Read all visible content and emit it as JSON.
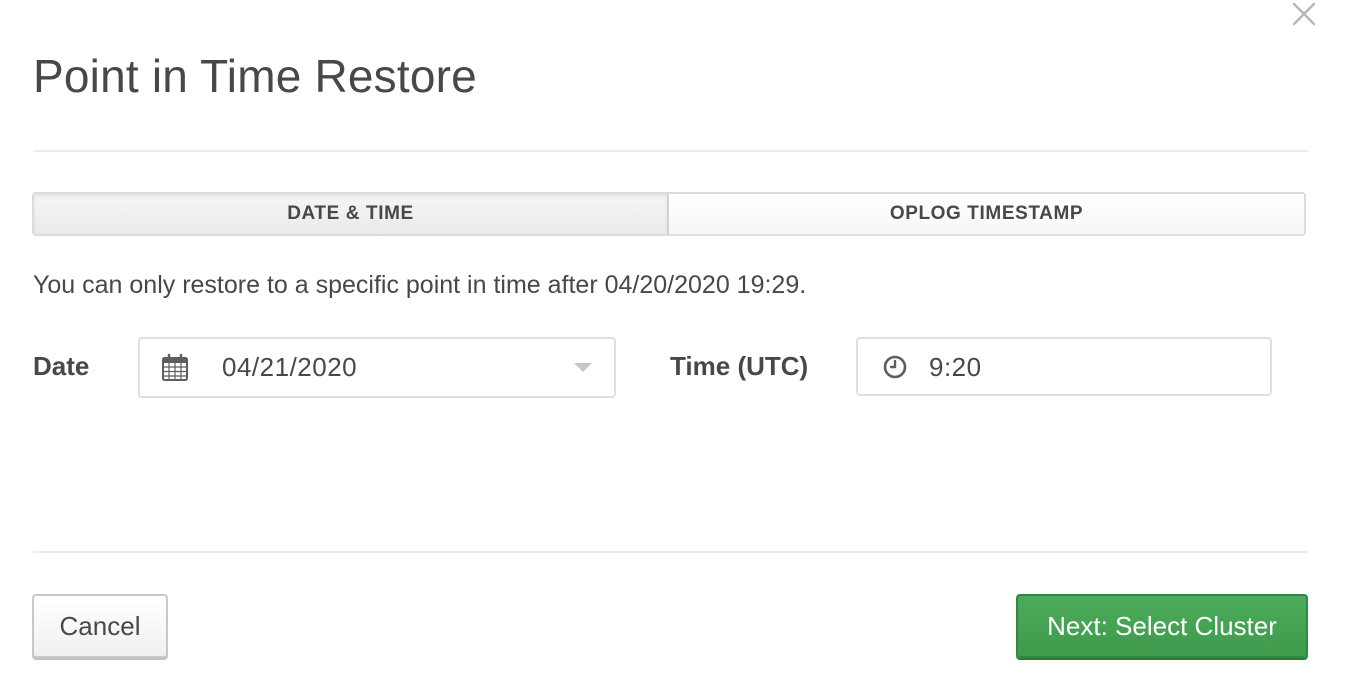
{
  "modal": {
    "title": "Point in Time Restore",
    "close_icon": "close-icon"
  },
  "tabs": [
    {
      "label": "DATE & TIME",
      "active": true
    },
    {
      "label": "OPLOG TIMESTAMP",
      "active": false
    }
  ],
  "info_text": "You can only restore to a specific point in time after 04/20/2020 19:29.",
  "date_field": {
    "label": "Date",
    "value": "04/21/2020",
    "icon": "calendar-icon"
  },
  "time_field": {
    "label": "Time (UTC)",
    "value": "9:20",
    "icon": "clock-icon"
  },
  "footer": {
    "cancel_label": "Cancel",
    "next_label": "Next: Select Cluster"
  },
  "colors": {
    "primary_green": "#44a350",
    "text": "#494747",
    "border": "#dee0e3"
  }
}
